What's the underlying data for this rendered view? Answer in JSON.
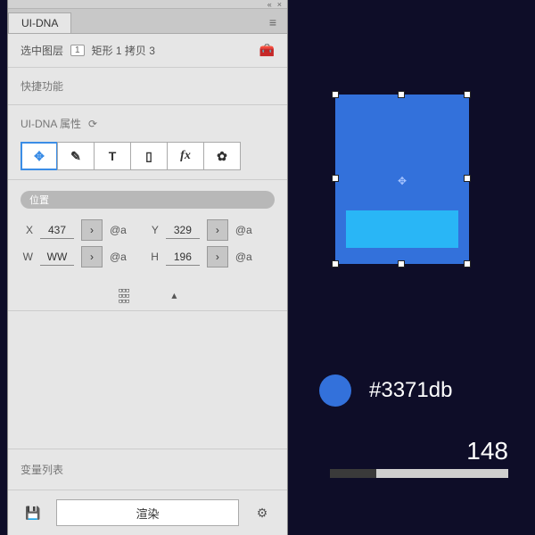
{
  "panel": {
    "title": "UI-DNA",
    "selected_layer_label": "选中图层",
    "selected_layer_count": "1",
    "selected_layer_name": "矩形 1 拷贝 3",
    "quick_label": "快捷功能",
    "props_title": "UI-DNA 属性",
    "toolbar": {
      "move": "✥",
      "pen": "✎",
      "text": "T",
      "page": "▯",
      "fx": "fx",
      "gear": "✿"
    },
    "position_pill": "位置",
    "coords": {
      "x_label": "X",
      "x_value": "437",
      "y_label": "Y",
      "y_value": "329",
      "w_label": "W",
      "w_value": "WW",
      "h_label": "H",
      "h_value": "196",
      "at": "@a"
    },
    "varlist_label": "变量列表",
    "render_label": "渲染"
  },
  "canvas": {
    "hex": "#3371db",
    "size_value": "148"
  }
}
